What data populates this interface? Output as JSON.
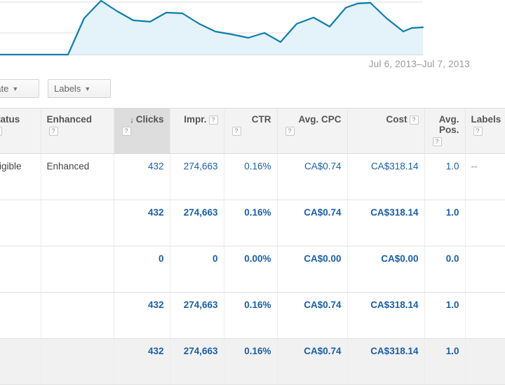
{
  "chart": {
    "date_range_label": "Jul 6, 2013–Jul 7, 2013",
    "line_color": "#0d7ead",
    "fill_color": "#e4f2f9"
  },
  "toolbar": {
    "automate_label": "nate",
    "automate_caret": "▼",
    "labels_label": "Labels",
    "labels_caret": "▼"
  },
  "table": {
    "sort_indicator": "↓",
    "help_glyph": "?",
    "columns": [
      {
        "key": "status",
        "label": "Status",
        "align": "left",
        "help": true,
        "sorted": false
      },
      {
        "key": "enhanced",
        "label": "Enhanced",
        "align": "left",
        "help": true,
        "sorted": false
      },
      {
        "key": "clicks",
        "label": "Clicks",
        "align": "right",
        "help": true,
        "sorted": true
      },
      {
        "key": "impr",
        "label": "Impr.",
        "align": "right",
        "help": true,
        "sorted": false
      },
      {
        "key": "ctr",
        "label": "CTR",
        "align": "right",
        "help": true,
        "sorted": false
      },
      {
        "key": "cpc",
        "label": "Avg. CPC",
        "align": "right",
        "help": true,
        "sorted": false
      },
      {
        "key": "cost",
        "label": "Cost",
        "align": "right",
        "help": true,
        "sorted": false
      },
      {
        "key": "pos",
        "label": "Avg. Pos.",
        "align": "right",
        "help": true,
        "sorted": false
      },
      {
        "key": "labels",
        "label": "Labels",
        "align": "left",
        "help": true,
        "sorted": false
      }
    ],
    "rows": [
      {
        "type": "data",
        "status": "Eligible",
        "enhanced": "Enhanced",
        "clicks": "432",
        "impr": "274,663",
        "ctr": "0.16%",
        "cpc": "CA$0.74",
        "cost": "CA$318.14",
        "pos": "1.0",
        "labels": "--"
      },
      {
        "type": "total",
        "status": "",
        "enhanced": "",
        "clicks": "432",
        "impr": "274,663",
        "ctr": "0.16%",
        "cpc": "CA$0.74",
        "cost": "CA$318.14",
        "pos": "1.0",
        "labels": ""
      },
      {
        "type": "total",
        "status": "",
        "enhanced": "",
        "clicks": "0",
        "impr": "0",
        "ctr": "0.00%",
        "cpc": "CA$0.00",
        "cost": "CA$0.00",
        "pos": "0.0",
        "labels": ""
      },
      {
        "type": "total",
        "status": "",
        "enhanced": "",
        "clicks": "432",
        "impr": "274,663",
        "ctr": "0.16%",
        "cpc": "CA$0.74",
        "cost": "CA$318.14",
        "pos": "1.0",
        "labels": ""
      },
      {
        "type": "grand",
        "status": "",
        "enhanced": "",
        "clicks": "432",
        "impr": "274,663",
        "ctr": "0.16%",
        "cpc": "CA$0.74",
        "cost": "CA$318.14",
        "pos": "1.0",
        "labels": ""
      }
    ]
  },
  "chart_data": {
    "type": "area",
    "title": "",
    "xlabel": "",
    "ylabel": "",
    "legend": [],
    "grid": true,
    "x": [
      0,
      1,
      2,
      3,
      4,
      5,
      6,
      7,
      8,
      9,
      10,
      11,
      12,
      13,
      14,
      15,
      16,
      17,
      18,
      19,
      20,
      21,
      22,
      23,
      24,
      25
    ],
    "values": [
      0,
      0,
      0,
      0,
      0,
      41,
      76,
      68,
      56,
      60,
      71,
      69,
      55,
      47,
      42,
      35,
      36,
      52,
      67,
      53,
      45,
      62,
      84,
      88,
      70,
      55,
      58
    ],
    "series": [
      {
        "name": "Clicks",
        "values": [
          0,
          0,
          0,
          0,
          0,
          41,
          76,
          68,
          56,
          60,
          71,
          69,
          55,
          47,
          42,
          35,
          36,
          52,
          67,
          53,
          45,
          62,
          84,
          88,
          70,
          55,
          58
        ]
      }
    ],
    "annotations": [
      "Jul 6, 2013–Jul 7, 2013"
    ]
  }
}
